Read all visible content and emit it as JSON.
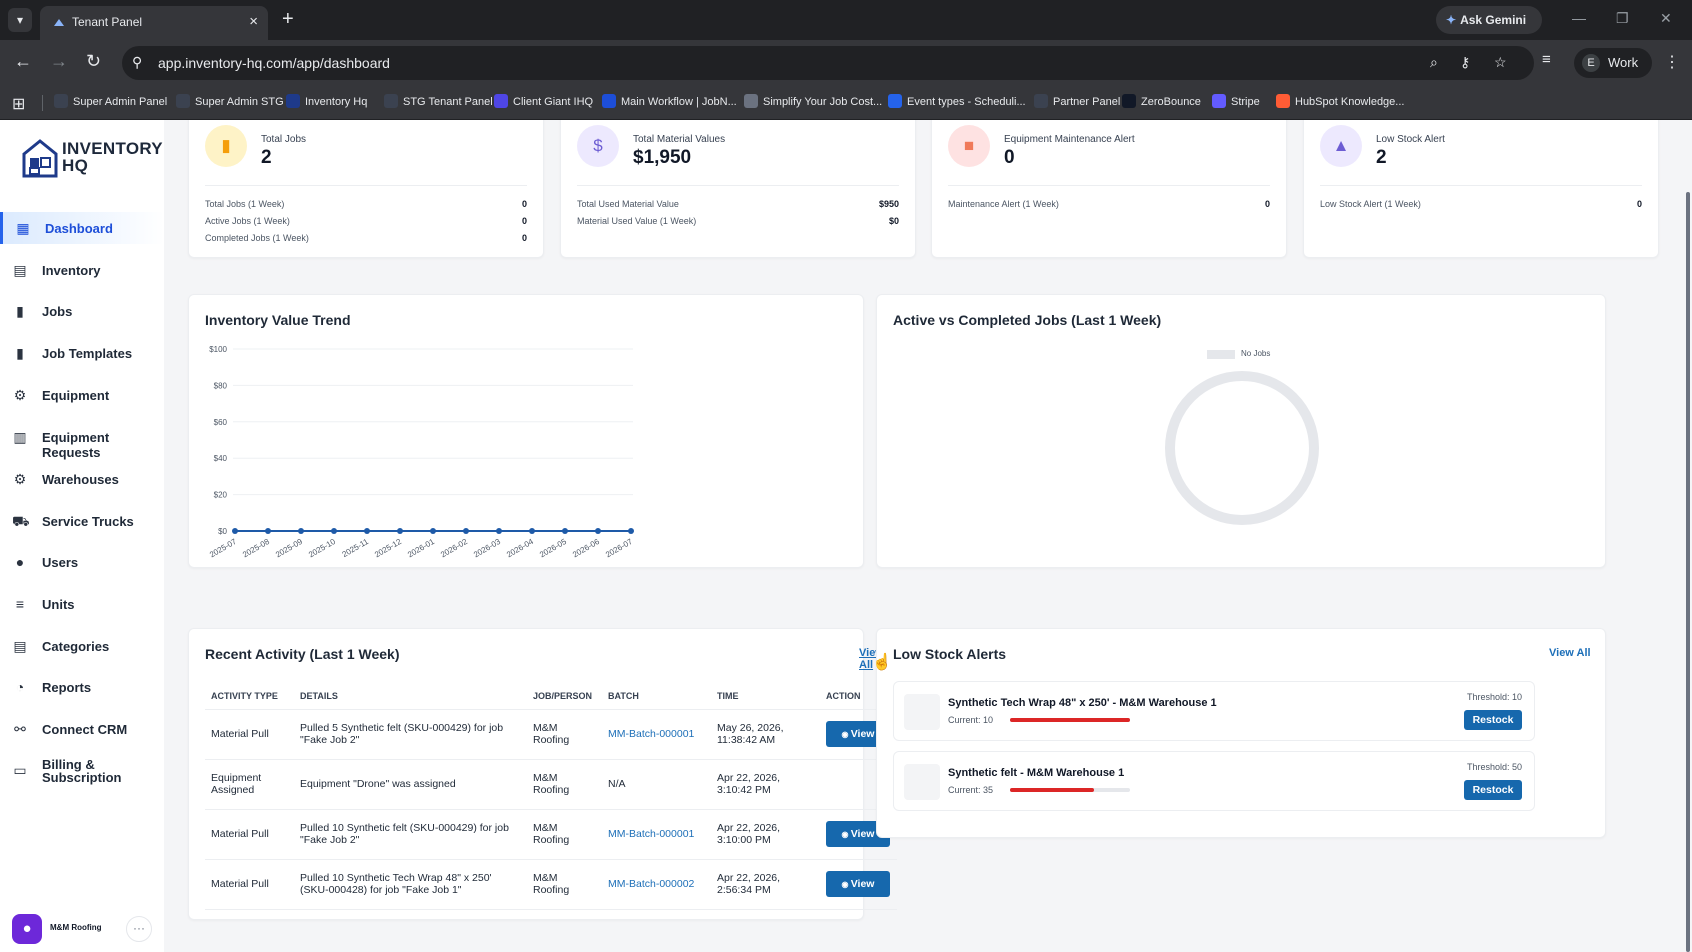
{
  "browser": {
    "tab_title": "Tenant Panel",
    "url": "app.inventory-hq.com/app/dashboard",
    "gemini_label": "Ask Gemini",
    "profile_initial": "E",
    "profile_name": "Work",
    "bookmarks": [
      {
        "label": "Super Admin Panel",
        "color": "#3b4250"
      },
      {
        "label": "Super Admin STG",
        "color": "#3b4250"
      },
      {
        "label": "Inventory Hq",
        "color": "#1e3a8a"
      },
      {
        "label": "STG Tenant Panel",
        "color": "#3b4250"
      },
      {
        "label": "Client Giant IHQ",
        "color": "#4f46e5"
      },
      {
        "label": "Main Workflow | JobN...",
        "color": "#1d4ed8"
      },
      {
        "label": "Simplify Your Job Cost...",
        "color": "#6b7280"
      },
      {
        "label": "Event types - Scheduli...",
        "color": "#2563eb"
      },
      {
        "label": "Partner Panel",
        "color": "#3b4250"
      },
      {
        "label": "ZeroBounce",
        "color": "#111827"
      },
      {
        "label": "Stripe",
        "color": "#635bff"
      },
      {
        "label": "HubSpot Knowledge...",
        "color": "#ff5c35"
      }
    ]
  },
  "app": {
    "logo_line1": "INVENTORY",
    "logo_line2": "HQ",
    "nav": [
      {
        "label": "Dashboard",
        "icon": "dashboard-icon",
        "glyph": "▦"
      },
      {
        "label": "Inventory",
        "icon": "inventory-icon",
        "glyph": "▤"
      },
      {
        "label": "Jobs",
        "icon": "jobs-icon",
        "glyph": "▮"
      },
      {
        "label": "Job Templates",
        "icon": "job-templates-icon",
        "glyph": "▮"
      },
      {
        "label": "Equipment",
        "icon": "equipment-icon",
        "glyph": "⚙"
      },
      {
        "label": "Equipment Requests",
        "icon": "equipment-requests-icon",
        "glyph": "▥"
      },
      {
        "label": "Warehouses",
        "icon": "warehouses-icon",
        "glyph": "⚙"
      },
      {
        "label": "Service Trucks",
        "icon": "truck-icon",
        "glyph": "⛟"
      },
      {
        "label": "Users",
        "icon": "users-icon",
        "glyph": "●"
      },
      {
        "label": "Units",
        "icon": "units-icon",
        "glyph": "≡"
      },
      {
        "label": "Categories",
        "icon": "categories-icon",
        "glyph": "▤"
      },
      {
        "label": "Reports",
        "icon": "reports-icon",
        "glyph": "◔"
      },
      {
        "label": "Connect CRM",
        "icon": "crm-icon",
        "glyph": "⚯"
      },
      {
        "label": "Billing & Subscription",
        "icon": "billing-icon",
        "glyph": "▭"
      }
    ],
    "user_name": "M&M Roofing"
  },
  "stats": [
    {
      "title": "Total Jobs",
      "value": "2",
      "icon": "briefcase-icon",
      "glyph": "▮",
      "bg": "#fef3c7",
      "fg": "#f59e0b",
      "rows": [
        {
          "label": "Total Jobs (1 Week)",
          "value": "0"
        },
        {
          "label": "Active Jobs (1 Week)",
          "value": "0"
        },
        {
          "label": "Completed Jobs (1 Week)",
          "value": "0"
        }
      ]
    },
    {
      "title": "Total Material Values",
      "value": "$1,950",
      "icon": "dollar-icon",
      "glyph": "$",
      "bg": "#ede9fe",
      "fg": "#6d5dd3",
      "rows": [
        {
          "label": "Total Used Material Value",
          "value": "$950"
        },
        {
          "label": "Material Used Value (1 Week)",
          "value": "$0"
        }
      ]
    },
    {
      "title": "Equipment Maintenance Alert",
      "value": "0",
      "icon": "toolbox-icon",
      "glyph": "■",
      "bg": "#fee2e2",
      "fg": "#f07a5a",
      "rows": [
        {
          "label": "Maintenance Alert (1 Week)",
          "value": "0"
        }
      ]
    },
    {
      "title": "Low Stock Alert",
      "value": "2",
      "icon": "warning-icon",
      "glyph": "▲",
      "bg": "#ede9fe",
      "fg": "#6d5dd3",
      "rows": [
        {
          "label": "Low Stock Alert (1 Week)",
          "value": "0"
        }
      ]
    }
  ],
  "trend": {
    "title": "Inventory Value Trend",
    "chart_data": {
      "type": "line",
      "categories": [
        "2025-07",
        "2025-08",
        "2025-09",
        "2025-10",
        "2025-11",
        "2025-12",
        "2026-01",
        "2026-02",
        "2026-03",
        "2026-04",
        "2026-05",
        "2026-06",
        "2026-07"
      ],
      "values": [
        0,
        0,
        0,
        0,
        0,
        0,
        0,
        0,
        0,
        0,
        0,
        0,
        0
      ],
      "y_ticks": [
        "$100",
        "$80",
        "$60",
        "$40",
        "$20",
        "$0"
      ],
      "ylim": [
        0,
        100
      ],
      "grid": true,
      "color": "#1e5aa8"
    }
  },
  "jobs_chart": {
    "title": "Active vs Completed Jobs (Last 1 Week)",
    "chart_data": {
      "type": "pie",
      "categories": [
        "No Jobs"
      ],
      "values": [
        1
      ],
      "legend": "top"
    },
    "legend_label": "No Jobs"
  },
  "activity": {
    "title": "Recent Activity (Last 1 Week)",
    "view_all": "View All",
    "columns": [
      "ACTIVITY TYPE",
      "DETAILS",
      "JOB/PERSON",
      "BATCH",
      "TIME",
      "ACTION"
    ],
    "rows": [
      {
        "type": "Material Pull",
        "details": "Pulled 5 Synthetic felt (SKU-000429) for job \"Fake Job 2\"",
        "person": "M&M Roofing",
        "batch": "MM-Batch-000001",
        "time": "May 26, 2026, 11:38:42 AM",
        "action": "View"
      },
      {
        "type": "Equipment Assigned",
        "details": "Equipment \"Drone\" was assigned",
        "person": "M&M Roofing",
        "batch": "N/A",
        "time": "Apr 22, 2026, 3:10:42 PM",
        "action": ""
      },
      {
        "type": "Material Pull",
        "details": "Pulled 10 Synthetic felt (SKU-000429) for job \"Fake Job 2\"",
        "person": "M&M Roofing",
        "batch": "MM-Batch-000001",
        "time": "Apr 22, 2026, 3:10:00 PM",
        "action": "View"
      },
      {
        "type": "Material Pull",
        "details": "Pulled 10 Synthetic Tech Wrap 48\" x 250' (SKU-000428) for job \"Fake Job 1\"",
        "person": "M&M Roofing",
        "batch": "MM-Batch-000002",
        "time": "Apr 22, 2026, 2:56:34 PM",
        "action": "View"
      }
    ]
  },
  "low_stock": {
    "title": "Low Stock Alerts",
    "view_all": "View All",
    "items": [
      {
        "name": "Synthetic Tech Wrap 48\" x 250' - M&M Warehouse 1",
        "current": "Current: 10",
        "threshold": "Threshold: 10",
        "level": 1.0,
        "action": "Restock"
      },
      {
        "name": "Synthetic felt - M&M Warehouse 1",
        "current": "Current: 35",
        "threshold": "Threshold: 50",
        "level": 0.7,
        "action": "Restock"
      }
    ]
  }
}
